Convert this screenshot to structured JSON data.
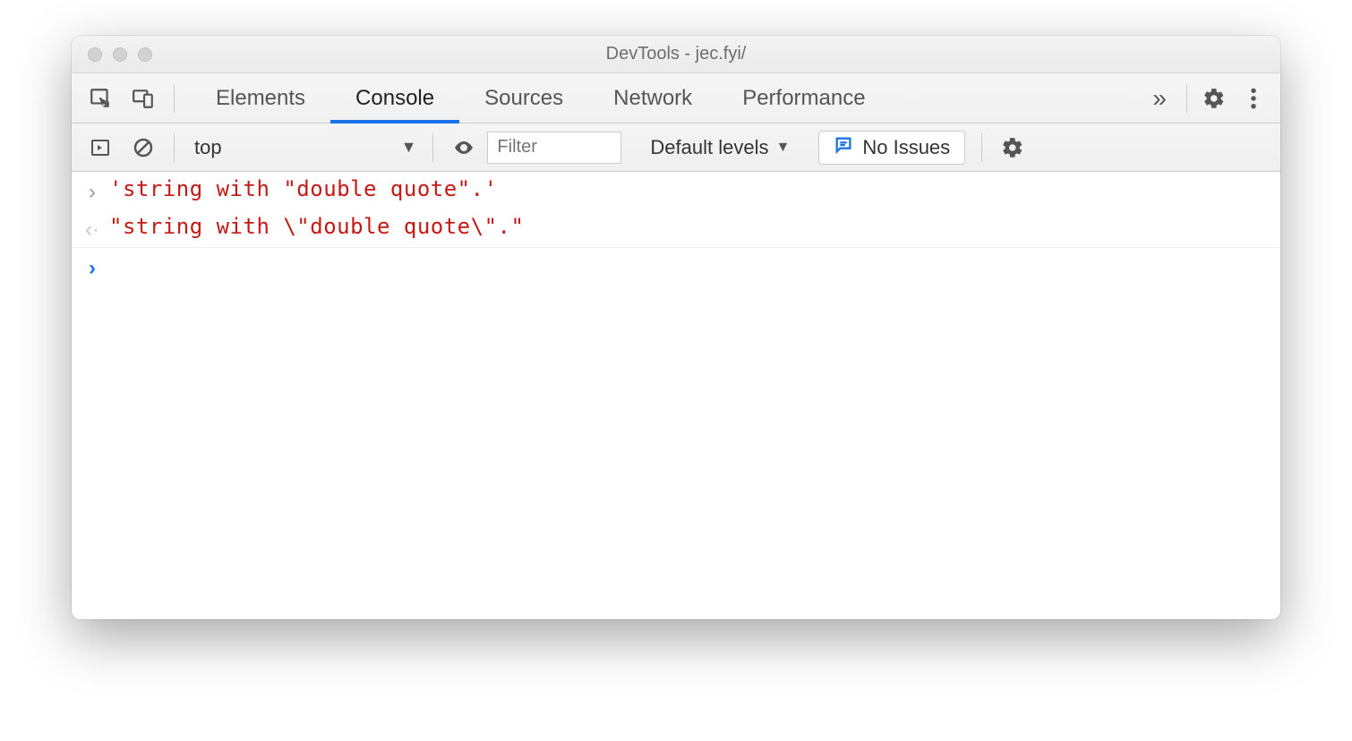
{
  "window": {
    "title": "DevTools - jec.fyi/"
  },
  "tabstrip": {
    "tabs": [
      "Elements",
      "Console",
      "Sources",
      "Network",
      "Performance"
    ],
    "active_index": 1
  },
  "console_toolbar": {
    "context": "top",
    "filter_placeholder": "Filter",
    "levels_label": "Default levels",
    "issues_label": "No Issues"
  },
  "console": {
    "rows": [
      {
        "kind": "input",
        "text": "'string with \"double quote\".'"
      },
      {
        "kind": "output",
        "text": "\"string with \\\"double quote\\\".\""
      }
    ]
  }
}
